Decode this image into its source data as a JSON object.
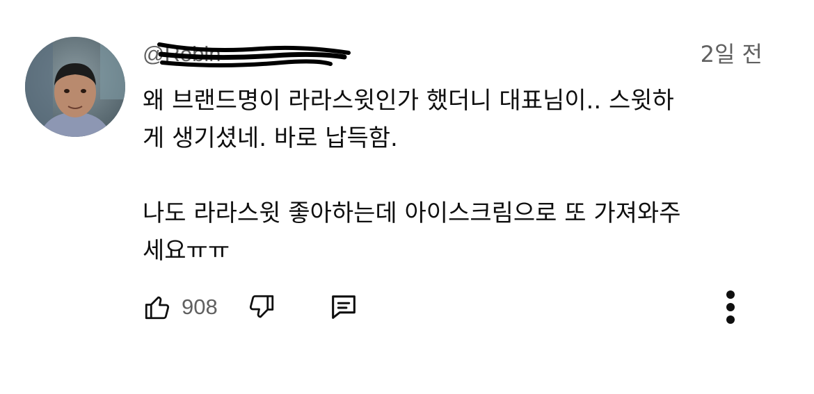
{
  "comment": {
    "author_handle": "@Robin",
    "timestamp": "2일 전",
    "body_lines": [
      "왜 브랜드명이 라라스윗인가 했더니 대표님이.. 스윗하",
      "게 생기셨네. 바로 납득함.",
      "",
      "나도 라라스윗 좋아하는데 아이스크림으로 또 가져와주",
      "세요ㅠㅠ"
    ],
    "like_count": "908"
  },
  "icons": {
    "like": "thumbs-up-icon",
    "dislike": "thumbs-down-icon",
    "reply": "comment-icon",
    "more": "more-vertical-icon"
  }
}
